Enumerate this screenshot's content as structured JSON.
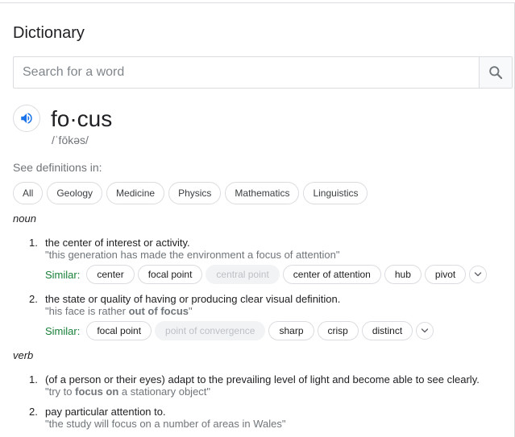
{
  "title": "Dictionary",
  "search": {
    "placeholder": "Search for a word"
  },
  "entry": {
    "word": "fo·cus",
    "phonetic": "/ˈfōkəs/"
  },
  "see_definitions": {
    "label": "See definitions in:",
    "chips": [
      "All",
      "Geology",
      "Medicine",
      "Physics",
      "Mathematics",
      "Linguistics"
    ]
  },
  "noun": {
    "label": "noun",
    "senses": [
      {
        "num": "1.",
        "definition": "the center of interest or activity.",
        "example": "\"this generation has made the environment a focus of attention\"",
        "similar_label": "Similar:",
        "similar": [
          "center",
          "focal point",
          "central point",
          "center of attention",
          "hub",
          "pivot"
        ]
      },
      {
        "num": "2.",
        "definition": "the state or quality of having or producing clear visual definition.",
        "example_pre": "\"his face is rather ",
        "example_bold": "out of focus",
        "example_post": "\"",
        "similar_label": "Similar:",
        "similar": [
          "focal point",
          "point of convergence",
          "sharp",
          "crisp",
          "distinct"
        ]
      }
    ]
  },
  "verb": {
    "label": "verb",
    "senses": [
      {
        "num": "1.",
        "definition": "(of a person or their eyes) adapt to the prevailing level of light and become able to see clearly.",
        "example_pre": "\"try to ",
        "example_bold": "focus on",
        "example_post": " a stationary object\""
      },
      {
        "num": "2.",
        "definition": "pay particular attention to.",
        "example": "\"the study will focus on a number of areas in Wales\""
      }
    ]
  },
  "colors": {
    "similar_label": "#188038",
    "icon_blue": "#1a73e8",
    "muted_chip_text": "#bdc1c6"
  }
}
